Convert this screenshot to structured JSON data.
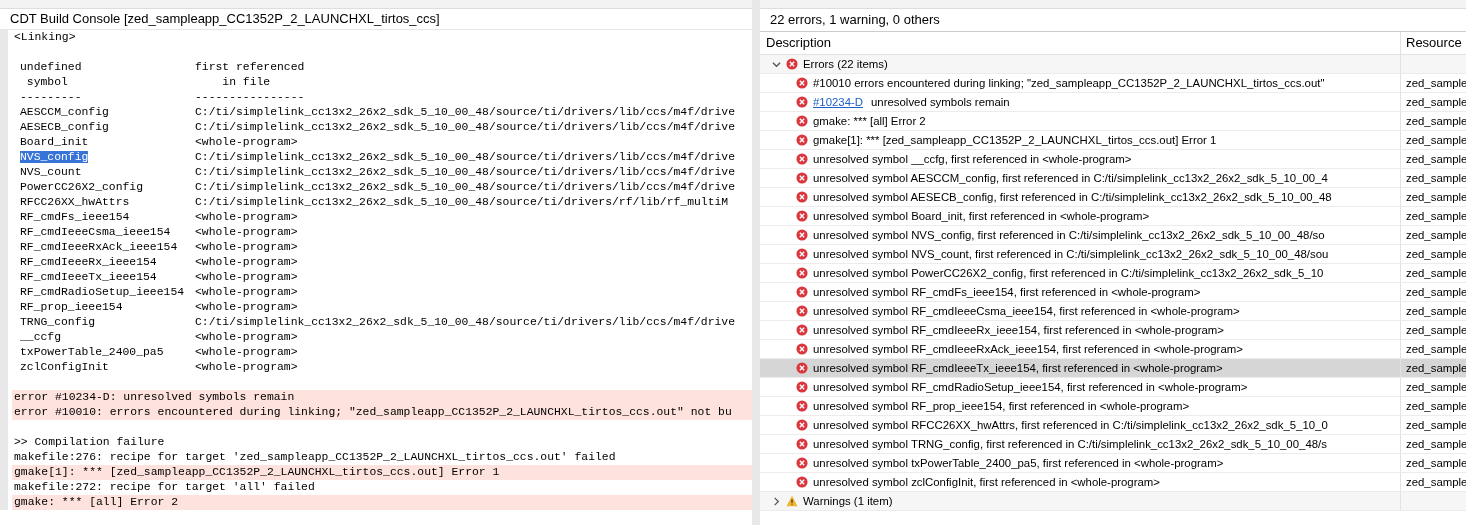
{
  "console": {
    "title": "CDT Build Console [zed_sampleapp_CC1352P_2_LAUNCHXL_tirtos_ccs]",
    "lines": [
      {
        "kind": "text",
        "text": "<Linking>"
      },
      {
        "kind": "blank"
      },
      {
        "kind": "pair",
        "symbol": "undefined",
        "file": "first referenced"
      },
      {
        "kind": "pair",
        "symbol": " symbol",
        "file": "    in file"
      },
      {
        "kind": "pair",
        "symbol": "---------",
        "file": "----------------"
      },
      {
        "kind": "pair",
        "symbol": "AESCCM_config",
        "file": "C:/ti/simplelink_cc13x2_26x2_sdk_5_10_00_48/source/ti/drivers/lib/ccs/m4f/drive"
      },
      {
        "kind": "pair",
        "symbol": "AESECB_config",
        "file": "C:/ti/simplelink_cc13x2_26x2_sdk_5_10_00_48/source/ti/drivers/lib/ccs/m4f/drive"
      },
      {
        "kind": "pair",
        "symbol": "Board_init",
        "file": "<whole-program>"
      },
      {
        "kind": "pair",
        "symbol": "NVS_config",
        "file": "C:/ti/simplelink_cc13x2_26x2_sdk_5_10_00_48/source/ti/drivers/lib/ccs/m4f/drive",
        "selected": true
      },
      {
        "kind": "pair",
        "symbol": "NVS_count",
        "file": "C:/ti/simplelink_cc13x2_26x2_sdk_5_10_00_48/source/ti/drivers/lib/ccs/m4f/drive"
      },
      {
        "kind": "pair",
        "symbol": "PowerCC26X2_config",
        "file": "C:/ti/simplelink_cc13x2_26x2_sdk_5_10_00_48/source/ti/drivers/lib/ccs/m4f/drive"
      },
      {
        "kind": "pair",
        "symbol": "RFCC26XX_hwAttrs",
        "file": "C:/ti/simplelink_cc13x2_26x2_sdk_5_10_00_48/source/ti/drivers/rf/lib/rf_multiM"
      },
      {
        "kind": "pair",
        "symbol": "RF_cmdFs_ieee154",
        "file": "<whole-program>"
      },
      {
        "kind": "pair",
        "symbol": "RF_cmdIeeeCsma_ieee154",
        "file": "<whole-program>"
      },
      {
        "kind": "pair",
        "symbol": "RF_cmdIeeeRxAck_ieee154",
        "file": "<whole-program>"
      },
      {
        "kind": "pair",
        "symbol": "RF_cmdIeeeRx_ieee154",
        "file": "<whole-program>"
      },
      {
        "kind": "pair",
        "symbol": "RF_cmdIeeeTx_ieee154",
        "file": "<whole-program>"
      },
      {
        "kind": "pair",
        "symbol": "RF_cmdRadioSetup_ieee154",
        "file": "<whole-program>"
      },
      {
        "kind": "pair",
        "symbol": "RF_prop_ieee154",
        "file": "<whole-program>"
      },
      {
        "kind": "pair",
        "symbol": "TRNG_config",
        "file": "C:/ti/simplelink_cc13x2_26x2_sdk_5_10_00_48/source/ti/drivers/lib/ccs/m4f/drive"
      },
      {
        "kind": "pair",
        "symbol": "__ccfg",
        "file": "<whole-program>"
      },
      {
        "kind": "pair",
        "symbol": "txPowerTable_2400_pa5",
        "file": "<whole-program>"
      },
      {
        "kind": "pair",
        "symbol": "zclConfigInit",
        "file": "<whole-program>"
      },
      {
        "kind": "blank"
      },
      {
        "kind": "error",
        "text": "error #10234-D: unresolved symbols remain"
      },
      {
        "kind": "error",
        "text": "error #10010: errors encountered during linking; \"zed_sampleapp_CC1352P_2_LAUNCHXL_tirtos_ccs.out\" not bu"
      },
      {
        "kind": "blank"
      },
      {
        "kind": "text",
        "text": ">> Compilation failure"
      },
      {
        "kind": "text",
        "text": "makefile:276: recipe for target 'zed_sampleapp_CC1352P_2_LAUNCHXL_tirtos_ccs.out' failed"
      },
      {
        "kind": "error",
        "text": "gmake[1]: *** [zed_sampleapp_CC1352P_2_LAUNCHXL_tirtos_ccs.out] Error 1"
      },
      {
        "kind": "text",
        "text": "makefile:272: recipe for target 'all' failed"
      },
      {
        "kind": "error",
        "text": "gmake: *** [all] Error 2"
      }
    ]
  },
  "problems": {
    "summary": "22 errors, 1 warning, 0 others",
    "columns": [
      "Description",
      "Resource"
    ],
    "groups": [
      {
        "kind": "error",
        "label": "Errors (22 items)",
        "expanded": true,
        "items": [
          {
            "description": "#10010 errors encountered during linking; \"zed_sampleapp_CC1352P_2_LAUNCHXL_tirtos_ccs.out\"",
            "resource": "zed_sample",
            "selected": false
          },
          {
            "link": "#10234-D",
            "description": "unresolved symbols remain",
            "resource": "zed_sample",
            "selected": false
          },
          {
            "description": "gmake: *** [all] Error 2",
            "resource": "zed_sample",
            "selected": false
          },
          {
            "description": "gmake[1]: *** [zed_sampleapp_CC1352P_2_LAUNCHXL_tirtos_ccs.out] Error 1",
            "resource": "zed_sample",
            "selected": false
          },
          {
            "description": "unresolved symbol __ccfg, first referenced in <whole-program>",
            "resource": "zed_sample",
            "selected": false
          },
          {
            "description": "unresolved symbol AESCCM_config, first referenced in C:/ti/simplelink_cc13x2_26x2_sdk_5_10_00_4",
            "resource": "zed_sample",
            "selected": false
          },
          {
            "description": "unresolved symbol AESECB_config, first referenced in C:/ti/simplelink_cc13x2_26x2_sdk_5_10_00_48",
            "resource": "zed_sample",
            "selected": false
          },
          {
            "description": "unresolved symbol Board_init, first referenced in <whole-program>",
            "resource": "zed_sample",
            "selected": false
          },
          {
            "description": "unresolved symbol NVS_config, first referenced in C:/ti/simplelink_cc13x2_26x2_sdk_5_10_00_48/so",
            "resource": "zed_sample",
            "selected": false
          },
          {
            "description": "unresolved symbol NVS_count, first referenced in C:/ti/simplelink_cc13x2_26x2_sdk_5_10_00_48/sou",
            "resource": "zed_sample",
            "selected": false
          },
          {
            "description": "unresolved symbol PowerCC26X2_config, first referenced in C:/ti/simplelink_cc13x2_26x2_sdk_5_10",
            "resource": "zed_sample",
            "selected": false
          },
          {
            "description": "unresolved symbol RF_cmdFs_ieee154, first referenced in <whole-program>",
            "resource": "zed_sample",
            "selected": false
          },
          {
            "description": "unresolved symbol RF_cmdIeeeCsma_ieee154, first referenced in <whole-program>",
            "resource": "zed_sample",
            "selected": false
          },
          {
            "description": "unresolved symbol RF_cmdIeeeRx_ieee154, first referenced in <whole-program>",
            "resource": "zed_sample",
            "selected": false
          },
          {
            "description": "unresolved symbol RF_cmdIeeeRxAck_ieee154, first referenced in <whole-program>",
            "resource": "zed_sample",
            "selected": false
          },
          {
            "description": "unresolved symbol RF_cmdIeeeTx_ieee154, first referenced in <whole-program>",
            "resource": "zed_sample",
            "selected": true
          },
          {
            "description": "unresolved symbol RF_cmdRadioSetup_ieee154, first referenced in <whole-program>",
            "resource": "zed_sample",
            "selected": false
          },
          {
            "description": "unresolved symbol RF_prop_ieee154, first referenced in <whole-program>",
            "resource": "zed_sample",
            "selected": false
          },
          {
            "description": "unresolved symbol RFCC26XX_hwAttrs, first referenced in C:/ti/simplelink_cc13x2_26x2_sdk_5_10_0",
            "resource": "zed_sample",
            "selected": false
          },
          {
            "description": "unresolved symbol TRNG_config, first referenced in C:/ti/simplelink_cc13x2_26x2_sdk_5_10_00_48/s",
            "resource": "zed_sample",
            "selected": false
          },
          {
            "description": "unresolved symbol txPowerTable_2400_pa5, first referenced in <whole-program>",
            "resource": "zed_sample",
            "selected": false
          },
          {
            "description": "unresolved symbol zclConfigInit, first referenced in <whole-program>",
            "resource": "zed_sample",
            "selected": false
          }
        ]
      },
      {
        "kind": "warning",
        "label": "Warnings (1 item)",
        "expanded": false
      }
    ]
  }
}
